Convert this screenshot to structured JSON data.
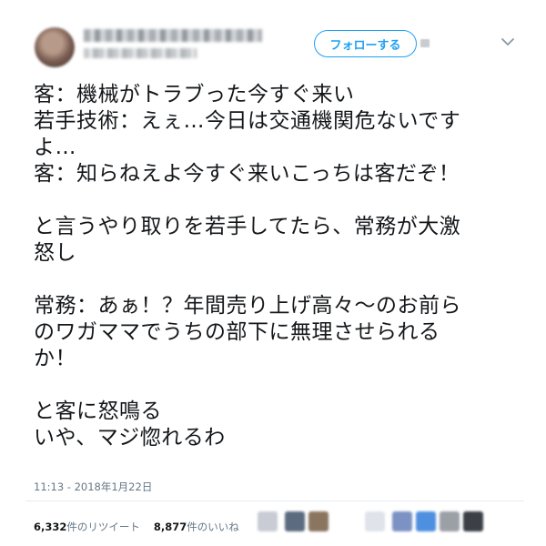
{
  "follow_button": {
    "label": "フォローする"
  },
  "tweet": {
    "text": "客：機械がトラブった今すぐ来い\n若手技術：えぇ…今日は交通機関危ないです\nよ…\n客：知らねえよ今すぐ来いこっちは客だぞ！\n\nと言うやり取りを若手してたら、常務が大激\n怒し\n\n常務：あぁ！？年間売り上げ高々〜のお前ら\nのワガママでうちの部下に無理させられる\nか！\n\nと客に怒鳴る\nいや、マジ惚れるわ",
    "timestamp": "11:13 - 2018年1月22日"
  },
  "stats": {
    "retweets_count": "6,332",
    "retweets_label": "件のリツイート",
    "likes_count": "8,877",
    "likes_label": "件のいいね"
  },
  "colors": {
    "accent": "#1da1f2",
    "text": "#14171a",
    "muted": "#657786",
    "divider": "#e6ecf0"
  },
  "icons": {
    "menu": "chevron-down-icon"
  }
}
